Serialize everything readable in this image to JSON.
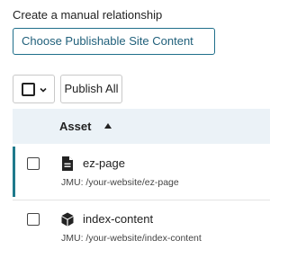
{
  "heading": "Create a manual relationship",
  "chooser": {
    "label": "Choose Publishable Site Content"
  },
  "toolbar": {
    "select_all_icon": "chevron-down-icon",
    "publish_all_label": "Publish All"
  },
  "table": {
    "column_header": "Asset",
    "sort": "ascending",
    "rows": [
      {
        "title": "ez-page",
        "icon": "page-icon",
        "path": "JMU: /your-website/ez-page",
        "selected": false
      },
      {
        "title": "index-content",
        "icon": "block-icon",
        "path": "JMU: /your-website/index-content",
        "selected": false
      }
    ]
  },
  "colors": {
    "accent": "#1f7a8c",
    "header_bg": "#ebf2f7",
    "chooser_border": "#1f6f8b"
  }
}
